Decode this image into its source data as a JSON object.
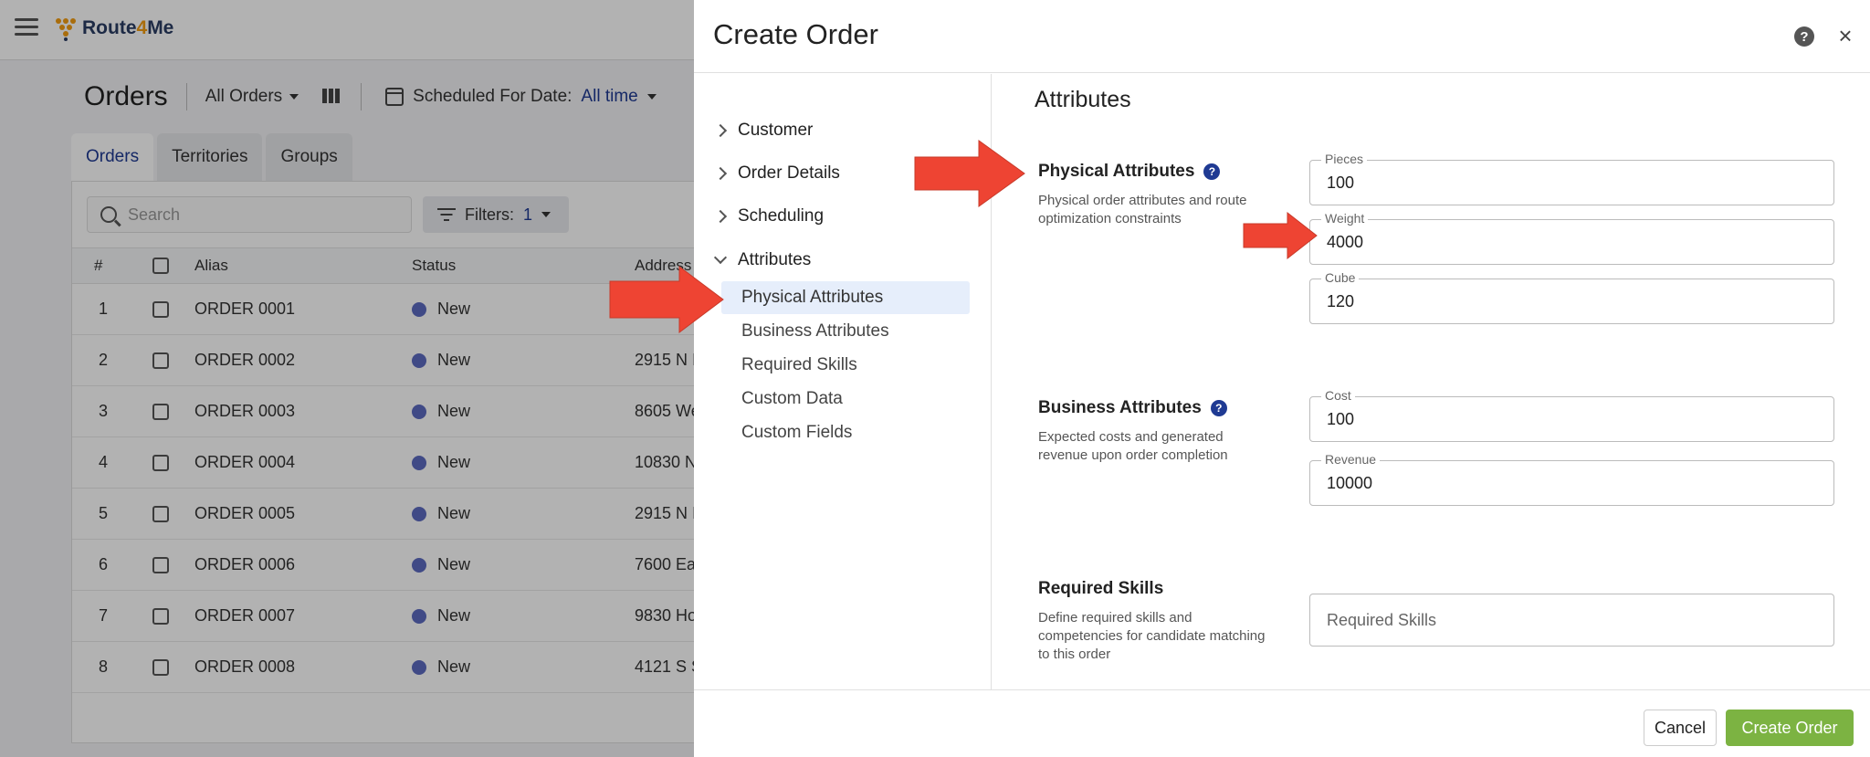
{
  "app": {
    "logo_prefix": "Route",
    "logo_four": "4",
    "logo_suffix": "Me"
  },
  "page": {
    "title": "Orders",
    "view_selector": "All Orders",
    "schedule_label": "Scheduled For Date:",
    "schedule_value": "All time"
  },
  "tabs": [
    "Orders",
    "Territories",
    "Groups"
  ],
  "toolbar": {
    "search_placeholder": "Search",
    "filters_label": "Filters:",
    "filters_count": "1"
  },
  "table": {
    "headers": {
      "num": "#",
      "alias": "Alias",
      "status": "Status",
      "address": "Address"
    },
    "rows": [
      {
        "num": "1",
        "alias": "ORDER 0001",
        "status": "New",
        "address": ""
      },
      {
        "num": "2",
        "alias": "ORDER 0002",
        "status": "New",
        "address": "2915 N I"
      },
      {
        "num": "3",
        "alias": "ORDER 0003",
        "status": "New",
        "address": "8605 We"
      },
      {
        "num": "4",
        "alias": "ORDER 0004",
        "status": "New",
        "address": "10830 N"
      },
      {
        "num": "5",
        "alias": "ORDER 0005",
        "status": "New",
        "address": "2915 N I"
      },
      {
        "num": "6",
        "alias": "ORDER 0006",
        "status": "New",
        "address": "7600 Ea"
      },
      {
        "num": "7",
        "alias": "ORDER 0007",
        "status": "New",
        "address": "9830 Ho"
      },
      {
        "num": "8",
        "alias": "ORDER 0008",
        "status": "New",
        "address": "4121 S S"
      }
    ]
  },
  "dialog": {
    "title": "Create Order",
    "help_glyph": "?",
    "close_glyph": "×",
    "nav": {
      "customer": "Customer",
      "order_details": "Order Details",
      "scheduling": "Scheduling",
      "attributes": "Attributes",
      "sub": [
        "Physical Attributes",
        "Business Attributes",
        "Required Skills",
        "Custom Data",
        "Custom Fields"
      ]
    },
    "content": {
      "section_title": "Attributes",
      "physical": {
        "title": "Physical Attributes",
        "desc": "Physical order attributes and route optimization constraints",
        "pieces_label": "Pieces",
        "pieces_value": "100",
        "weight_label": "Weight",
        "weight_value": "4000",
        "cube_label": "Cube",
        "cube_value": "120"
      },
      "business": {
        "title": "Business Attributes",
        "desc": "Expected costs and generated revenue upon order completion",
        "cost_label": "Cost",
        "cost_value": "100",
        "revenue_label": "Revenue",
        "revenue_value": "10000"
      },
      "skills": {
        "title": "Required Skills",
        "desc": "Define required skills and competencies for candidate matching to this order",
        "placeholder": "Required Skills"
      }
    },
    "footer": {
      "cancel": "Cancel",
      "create": "Create Order"
    }
  },
  "colors": {
    "accent": "#1f3a93",
    "status_new": "#5c6bc0",
    "create_button": "#7cb342",
    "annotation_arrow": "#ee4433",
    "nav_active_bg": "#e6eefb"
  }
}
